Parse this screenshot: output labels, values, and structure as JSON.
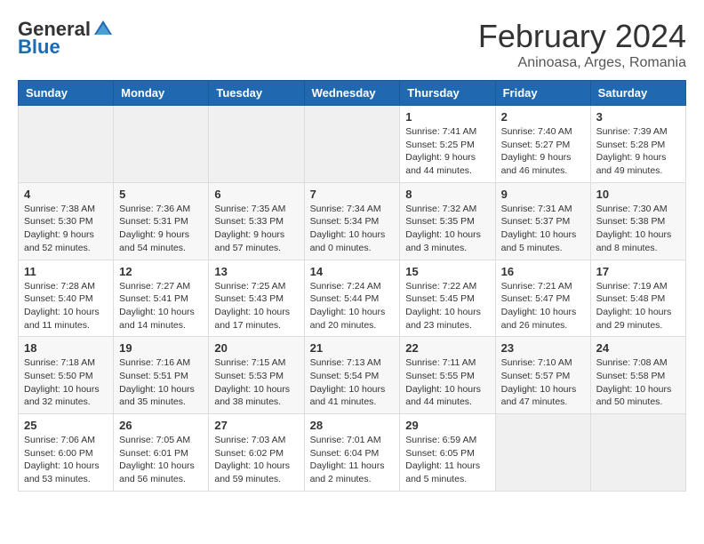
{
  "logo": {
    "general": "General",
    "blue": "Blue"
  },
  "title": "February 2024",
  "subtitle": "Aninoasa, Arges, Romania",
  "days_of_week": [
    "Sunday",
    "Monday",
    "Tuesday",
    "Wednesday",
    "Thursday",
    "Friday",
    "Saturday"
  ],
  "weeks": [
    [
      {
        "day": "",
        "info": ""
      },
      {
        "day": "",
        "info": ""
      },
      {
        "day": "",
        "info": ""
      },
      {
        "day": "",
        "info": ""
      },
      {
        "day": "1",
        "info": "Sunrise: 7:41 AM\nSunset: 5:25 PM\nDaylight: 9 hours\nand 44 minutes."
      },
      {
        "day": "2",
        "info": "Sunrise: 7:40 AM\nSunset: 5:27 PM\nDaylight: 9 hours\nand 46 minutes."
      },
      {
        "day": "3",
        "info": "Sunrise: 7:39 AM\nSunset: 5:28 PM\nDaylight: 9 hours\nand 49 minutes."
      }
    ],
    [
      {
        "day": "4",
        "info": "Sunrise: 7:38 AM\nSunset: 5:30 PM\nDaylight: 9 hours\nand 52 minutes."
      },
      {
        "day": "5",
        "info": "Sunrise: 7:36 AM\nSunset: 5:31 PM\nDaylight: 9 hours\nand 54 minutes."
      },
      {
        "day": "6",
        "info": "Sunrise: 7:35 AM\nSunset: 5:33 PM\nDaylight: 9 hours\nand 57 minutes."
      },
      {
        "day": "7",
        "info": "Sunrise: 7:34 AM\nSunset: 5:34 PM\nDaylight: 10 hours\nand 0 minutes."
      },
      {
        "day": "8",
        "info": "Sunrise: 7:32 AM\nSunset: 5:35 PM\nDaylight: 10 hours\nand 3 minutes."
      },
      {
        "day": "9",
        "info": "Sunrise: 7:31 AM\nSunset: 5:37 PM\nDaylight: 10 hours\nand 5 minutes."
      },
      {
        "day": "10",
        "info": "Sunrise: 7:30 AM\nSunset: 5:38 PM\nDaylight: 10 hours\nand 8 minutes."
      }
    ],
    [
      {
        "day": "11",
        "info": "Sunrise: 7:28 AM\nSunset: 5:40 PM\nDaylight: 10 hours\nand 11 minutes."
      },
      {
        "day": "12",
        "info": "Sunrise: 7:27 AM\nSunset: 5:41 PM\nDaylight: 10 hours\nand 14 minutes."
      },
      {
        "day": "13",
        "info": "Sunrise: 7:25 AM\nSunset: 5:43 PM\nDaylight: 10 hours\nand 17 minutes."
      },
      {
        "day": "14",
        "info": "Sunrise: 7:24 AM\nSunset: 5:44 PM\nDaylight: 10 hours\nand 20 minutes."
      },
      {
        "day": "15",
        "info": "Sunrise: 7:22 AM\nSunset: 5:45 PM\nDaylight: 10 hours\nand 23 minutes."
      },
      {
        "day": "16",
        "info": "Sunrise: 7:21 AM\nSunset: 5:47 PM\nDaylight: 10 hours\nand 26 minutes."
      },
      {
        "day": "17",
        "info": "Sunrise: 7:19 AM\nSunset: 5:48 PM\nDaylight: 10 hours\nand 29 minutes."
      }
    ],
    [
      {
        "day": "18",
        "info": "Sunrise: 7:18 AM\nSunset: 5:50 PM\nDaylight: 10 hours\nand 32 minutes."
      },
      {
        "day": "19",
        "info": "Sunrise: 7:16 AM\nSunset: 5:51 PM\nDaylight: 10 hours\nand 35 minutes."
      },
      {
        "day": "20",
        "info": "Sunrise: 7:15 AM\nSunset: 5:53 PM\nDaylight: 10 hours\nand 38 minutes."
      },
      {
        "day": "21",
        "info": "Sunrise: 7:13 AM\nSunset: 5:54 PM\nDaylight: 10 hours\nand 41 minutes."
      },
      {
        "day": "22",
        "info": "Sunrise: 7:11 AM\nSunset: 5:55 PM\nDaylight: 10 hours\nand 44 minutes."
      },
      {
        "day": "23",
        "info": "Sunrise: 7:10 AM\nSunset: 5:57 PM\nDaylight: 10 hours\nand 47 minutes."
      },
      {
        "day": "24",
        "info": "Sunrise: 7:08 AM\nSunset: 5:58 PM\nDaylight: 10 hours\nand 50 minutes."
      }
    ],
    [
      {
        "day": "25",
        "info": "Sunrise: 7:06 AM\nSunset: 6:00 PM\nDaylight: 10 hours\nand 53 minutes."
      },
      {
        "day": "26",
        "info": "Sunrise: 7:05 AM\nSunset: 6:01 PM\nDaylight: 10 hours\nand 56 minutes."
      },
      {
        "day": "27",
        "info": "Sunrise: 7:03 AM\nSunset: 6:02 PM\nDaylight: 10 hours\nand 59 minutes."
      },
      {
        "day": "28",
        "info": "Sunrise: 7:01 AM\nSunset: 6:04 PM\nDaylight: 11 hours\nand 2 minutes."
      },
      {
        "day": "29",
        "info": "Sunrise: 6:59 AM\nSunset: 6:05 PM\nDaylight: 11 hours\nand 5 minutes."
      },
      {
        "day": "",
        "info": ""
      },
      {
        "day": "",
        "info": ""
      }
    ]
  ]
}
